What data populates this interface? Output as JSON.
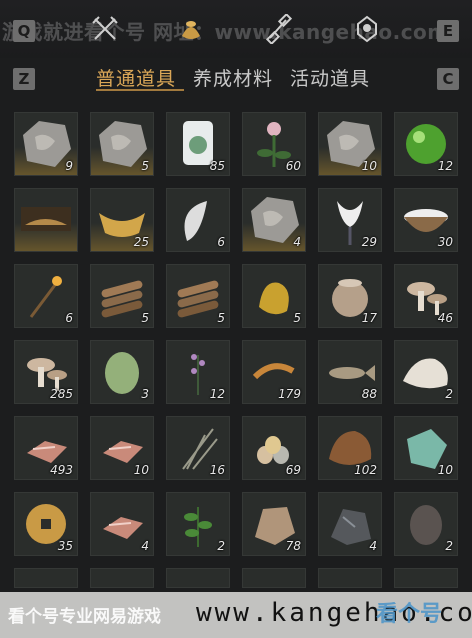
{
  "watermark_top": "游戏就进看个号   网址：www.kangehao.com",
  "keys": {
    "q": "Q",
    "e": "E",
    "z": "Z",
    "c": "C"
  },
  "top_icons": [
    "crossed-swords-icon",
    "coin-pouch-icon",
    "scroll-icon",
    "map-pin-icon"
  ],
  "tabs": [
    {
      "label": "普通道具",
      "active": true
    },
    {
      "label": "养成材料",
      "active": false
    },
    {
      "label": "活动道具",
      "active": false
    }
  ],
  "items": [
    {
      "icon": "stone-tablet-icon",
      "qty": "9",
      "rare": true
    },
    {
      "icon": "deer-carved-stone-icon",
      "qty": "5",
      "rare": true
    },
    {
      "icon": "white-jade-icon",
      "qty": "85",
      "rare": false
    },
    {
      "icon": "pink-flower-herb-icon",
      "qty": "60",
      "rare": false
    },
    {
      "icon": "flower-carved-stone-icon",
      "qty": "10",
      "rare": true
    },
    {
      "icon": "green-orb-icon",
      "qty": "12",
      "rare": false
    },
    {
      "icon": "landscape-painting-icon",
      "qty": "",
      "rare": true
    },
    {
      "icon": "gold-ingot-icon",
      "qty": "25",
      "rare": true
    },
    {
      "icon": "fox-tail-icon",
      "qty": "6",
      "rare": false
    },
    {
      "icon": "carved-stone-icon",
      "qty": "4",
      "rare": true
    },
    {
      "icon": "white-lily-icon",
      "qty": "29",
      "rare": false
    },
    {
      "icon": "milk-bowl-icon",
      "qty": "30",
      "rare": false
    },
    {
      "icon": "torch-icon",
      "qty": "6",
      "rare": false
    },
    {
      "icon": "firewood-icon",
      "qty": "5",
      "rare": false
    },
    {
      "icon": "firewood-icon",
      "qty": "5",
      "rare": false
    },
    {
      "icon": "gold-nugget-icon",
      "qty": "5",
      "rare": false
    },
    {
      "icon": "clay-pot-icon",
      "qty": "17",
      "rare": false
    },
    {
      "icon": "mushroom-icon",
      "qty": "46",
      "rare": false
    },
    {
      "icon": "mushroom-cluster-icon",
      "qty": "285",
      "rare": false
    },
    {
      "icon": "melon-icon",
      "qty": "3",
      "rare": false
    },
    {
      "icon": "purple-herb-icon",
      "qty": "12",
      "rare": false
    },
    {
      "icon": "shrimp-icon",
      "qty": "179",
      "rare": false
    },
    {
      "icon": "fish-icon",
      "qty": "88",
      "rare": false
    },
    {
      "icon": "white-fur-icon",
      "qty": "2",
      "rare": false
    },
    {
      "icon": "raw-meat-pile-icon",
      "qty": "493",
      "rare": false
    },
    {
      "icon": "meat-slices-icon",
      "qty": "10",
      "rare": false
    },
    {
      "icon": "dry-grass-icon",
      "qty": "16",
      "rare": false
    },
    {
      "icon": "eggs-icon",
      "qty": "69",
      "rare": false
    },
    {
      "icon": "brown-pelt-icon",
      "qty": "102",
      "rare": false
    },
    {
      "icon": "jade-stone-icon",
      "qty": "10",
      "rare": false
    },
    {
      "icon": "bronze-coin-icon",
      "qty": "35",
      "rare": false
    },
    {
      "icon": "meat-cut-icon",
      "qty": "4",
      "rare": false
    },
    {
      "icon": "green-herb-icon",
      "qty": "2",
      "rare": false
    },
    {
      "icon": "hide-icon",
      "qty": "78",
      "rare": false
    },
    {
      "icon": "dark-ore-icon",
      "qty": "4",
      "rare": false
    },
    {
      "icon": "dark-rock-icon",
      "qty": "2",
      "rare": false
    }
  ],
  "bottom_watermark": {
    "left_text": "看个号专业网易游戏",
    "url": "www.kangehao.com",
    "logo": "看个号"
  },
  "colors": {
    "background": "#1c1d1e",
    "tab_active": "#d9a657",
    "tab_inactive": "#c9c9c9",
    "slot": "#2a2d2b"
  }
}
